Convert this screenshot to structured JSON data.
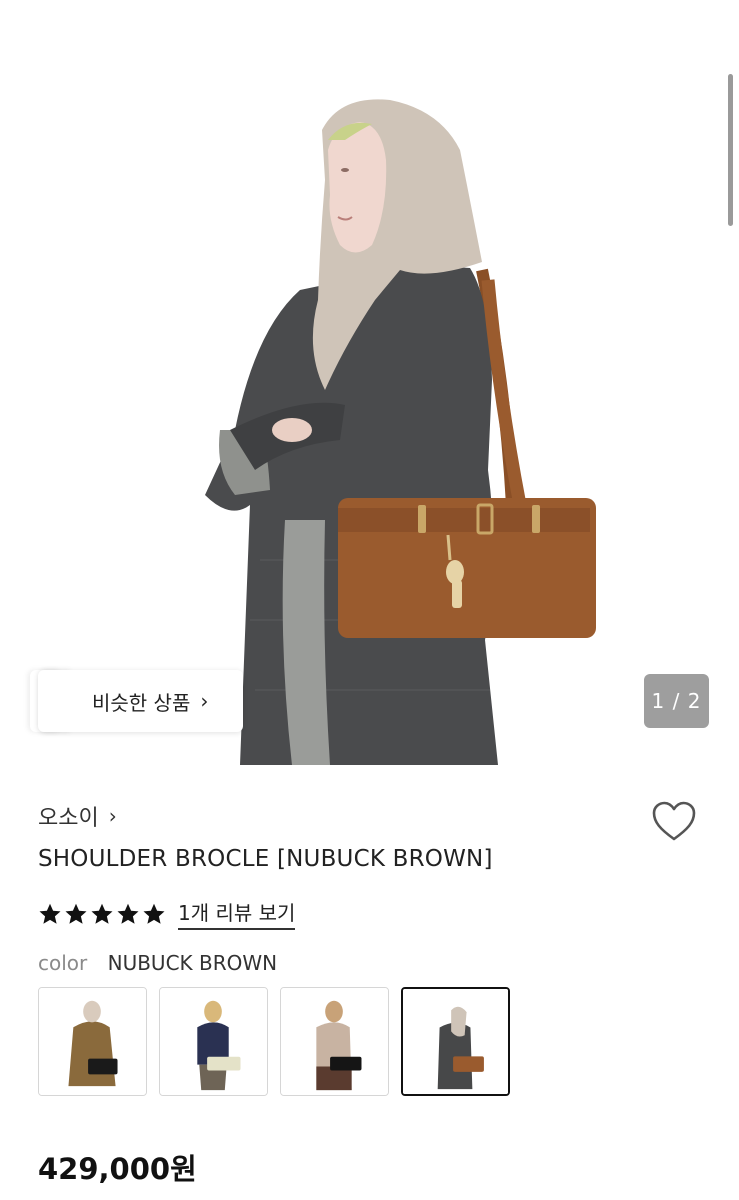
{
  "gallery": {
    "similar_products_label": "비슷한 상품",
    "page_indicator": "1 / 2"
  },
  "product": {
    "brand": "오소이",
    "title": "SHOULDER BROCLE [NUBUCK BROWN]",
    "rating_stars": 5,
    "review_link": "1개 리뷰 보기",
    "color_label": "color",
    "color_value": "NUBUCK BROWN",
    "price": "429,000원",
    "swatches_count": 4,
    "selected_swatch": 4
  },
  "icons": {
    "chevron": "chevron-right-icon",
    "wishlist": "heart-icon",
    "star": "star-icon"
  },
  "colors": {
    "bag_brown": "#9a5b2e",
    "coat_grey": "#4a4b4d",
    "scarf_beige": "#cfc4b8",
    "pager_bg": "#9e9e9e"
  }
}
